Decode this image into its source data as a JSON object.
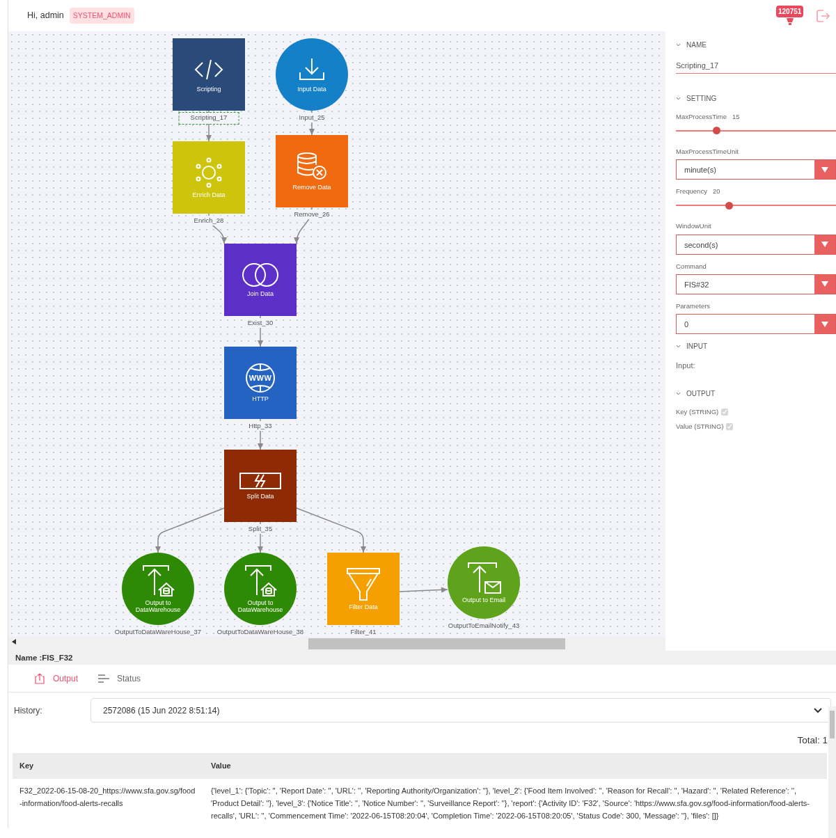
{
  "header": {
    "greeting": "Hi, admin",
    "role": "SYSTEM_ADMIN",
    "notification_count": "120751"
  },
  "nodes": [
    {
      "kind": "scripting",
      "title": "Scripting",
      "caption": "Scripting_17",
      "color": "#2a4a7a",
      "selected": true
    },
    {
      "kind": "input",
      "title": "Input Data",
      "caption": "Input_25",
      "color": "#1380c8",
      "selected": false
    },
    {
      "kind": "enrich",
      "title": "Enrich Data",
      "caption": "Enrich_28",
      "color": "#cfc40c",
      "selected": false
    },
    {
      "kind": "remove",
      "title": "Remove Data",
      "caption": "Remove_26",
      "color": "#f16a10",
      "selected": false
    },
    {
      "kind": "join",
      "title": "Join Data",
      "caption": "Exist_30",
      "color": "#5b2fc8",
      "selected": false
    },
    {
      "kind": "http",
      "title": "HTTP",
      "icon_text": "WWW",
      "caption": "Http_33",
      "color": "#2563c3",
      "selected": false
    },
    {
      "kind": "split",
      "title": "Split Data",
      "caption": "Split_35",
      "color": "#8e2a04",
      "selected": false
    },
    {
      "kind": "output_warehouse",
      "title": "Output to DataWarehouse",
      "caption": "OutputToDataWareHouse_37",
      "color": "#2e8a05",
      "selected": false
    },
    {
      "kind": "output_warehouse",
      "title": "Output to DataWarehouse",
      "caption": "OutputToDataWareHouse_38",
      "color": "#2e8a05",
      "selected": false
    },
    {
      "kind": "filter",
      "title": "Filter Data",
      "caption": "Filter_41",
      "color": "#f5a000",
      "selected": false
    },
    {
      "kind": "output_email",
      "title": "Output to Email",
      "caption": "OutputToEmailNotify_43",
      "color": "#5fa31c",
      "selected": false
    }
  ],
  "panel": {
    "sections": [
      {
        "title": "NAME",
        "fields": [
          {
            "kind": "text",
            "value": "Scripting_17"
          }
        ]
      },
      {
        "title": "SETTING",
        "fields": [
          {
            "kind": "slider",
            "label": "MaxProcessTime",
            "reading": "15",
            "level": 0.25
          },
          {
            "kind": "select",
            "label": "MaxProcessTimeUnit",
            "value": "minute(s)"
          },
          {
            "kind": "slider",
            "label": "Frequency",
            "reading": "20",
            "level": 0.33
          },
          {
            "kind": "select",
            "label": "WindowUnit",
            "value": "second(s)"
          },
          {
            "kind": "select",
            "label": "Command",
            "value": "FIS#32"
          },
          {
            "kind": "select",
            "label": "Parameters",
            "value": "0"
          }
        ]
      },
      {
        "title": "INPUT",
        "fields": [
          {
            "kind": "note",
            "label": "Input:"
          }
        ]
      },
      {
        "title": "OUTPUT",
        "fields": [
          {
            "kind": "checkbox",
            "label": "Key (STRING)",
            "checked": true,
            "disabled": true
          },
          {
            "kind": "checkbox",
            "label": "Value (STRING)",
            "checked": true,
            "disabled": true
          }
        ]
      }
    ]
  },
  "flow_name": "Name :FIS_F32",
  "tabs": [
    {
      "label": "Output",
      "selected": true
    },
    {
      "label": "Status",
      "selected": false
    }
  ],
  "history": {
    "label": "History:",
    "value": "2572086 (15 Jun 2022 8:51:14)"
  },
  "total": "Total: 1",
  "table": {
    "columns": [
      "Key",
      "Value"
    ],
    "rows": [
      [
        "F32_2022-06-15-08-20_https://www.sfa.gov.sg/food-information/food-alerts-recalls",
        "{'level_1': {'Topic': '', 'Report Date': '', 'URL': '', 'Reporting Authority/Organization': ''}, 'level_2': {'Food Item Involved': '', 'Reason for Recall': '', 'Hazard': '', 'Related Reference': '', 'Product Detail': ''}, 'level_3': {'Notice Title': '', 'Notice Number': '', 'Surveillance Report': ''}, 'report': {'Activity ID': 'F32', 'Source': 'https://www.sfa.gov.sg/food-information/food-alerts-recalls', 'URL': '', 'Commencement Time': '2022-06-15T08:20:04', 'Completion Time': '2022-06-15T08:20:05', 'Status Code': 300, 'Message': ''}, 'files': []}"
      ]
    ]
  }
}
